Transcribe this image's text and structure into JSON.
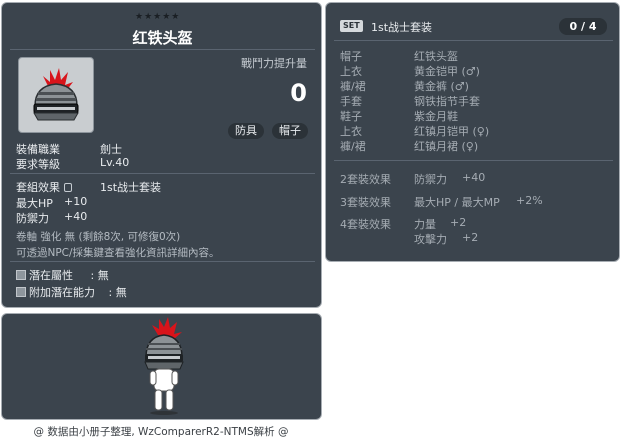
{
  "item_id": "01002025",
  "stars": "★★★★★",
  "item_name": "红铁头盔",
  "combat_power": {
    "label": "戰鬥力提升量",
    "value": "0"
  },
  "tags": [
    "防具",
    "帽子"
  ],
  "job": {
    "label": "裝備職業",
    "value": "劍士"
  },
  "req_level": {
    "label": "要求等級",
    "value": "Lv.40"
  },
  "set_effect": {
    "label": "套組效果",
    "value": "1st战士套装"
  },
  "stats": [
    {
      "label": "最大HP",
      "value": "+10"
    },
    {
      "label": "防禦力",
      "value": "+40"
    }
  ],
  "upgrade_info": "卷軸 強化 無 (剩餘8次, 可修復0次)",
  "npc_info": "可透過NPC/採集鍵查看強化資訊詳細內容。",
  "potentials": [
    {
      "label": "潛在屬性",
      "value": ": 無"
    },
    {
      "label": "附加潛在能力",
      "value": ": 無"
    }
  ],
  "set_panel": {
    "badge": "SET",
    "title": "1st战士套装",
    "count": "0 / 4",
    "items": [
      {
        "slot": "帽子",
        "name": "红铁头盔"
      },
      {
        "slot": "上衣",
        "name": "黄金铠甲 (♂)"
      },
      {
        "slot": "褲/裙",
        "name": "黄金裤 (♂)"
      },
      {
        "slot": "手套",
        "name": "钢铁指节手套"
      },
      {
        "slot": "鞋子",
        "name": "紫金月鞋"
      },
      {
        "slot": "上衣",
        "name": "红镇月铠甲 (♀)"
      },
      {
        "slot": "褲/裙",
        "name": "红镇月裙 (♀)"
      }
    ],
    "bonuses": [
      {
        "label": "2套裝效果",
        "effects": [
          {
            "stat": "防禦力",
            "value": "+40"
          }
        ]
      },
      {
        "label": "3套裝效果",
        "effects": [
          {
            "stat": "最大HP / 最大MP",
            "value": "+2%"
          }
        ]
      },
      {
        "label": "4套裝效果",
        "effects": [
          {
            "stat": "力量",
            "value": "+2"
          },
          {
            "stat": "攻擊力",
            "value": "+2"
          }
        ]
      }
    ]
  },
  "footer": "@ 数据由小册子整理, WzComparerR2-NTMS解析 @",
  "colors": {
    "panel_bg": "#3b444d",
    "panel_border": "#a7adb3",
    "text": "#e9ecef",
    "muted_text": "#a5acb3"
  }
}
